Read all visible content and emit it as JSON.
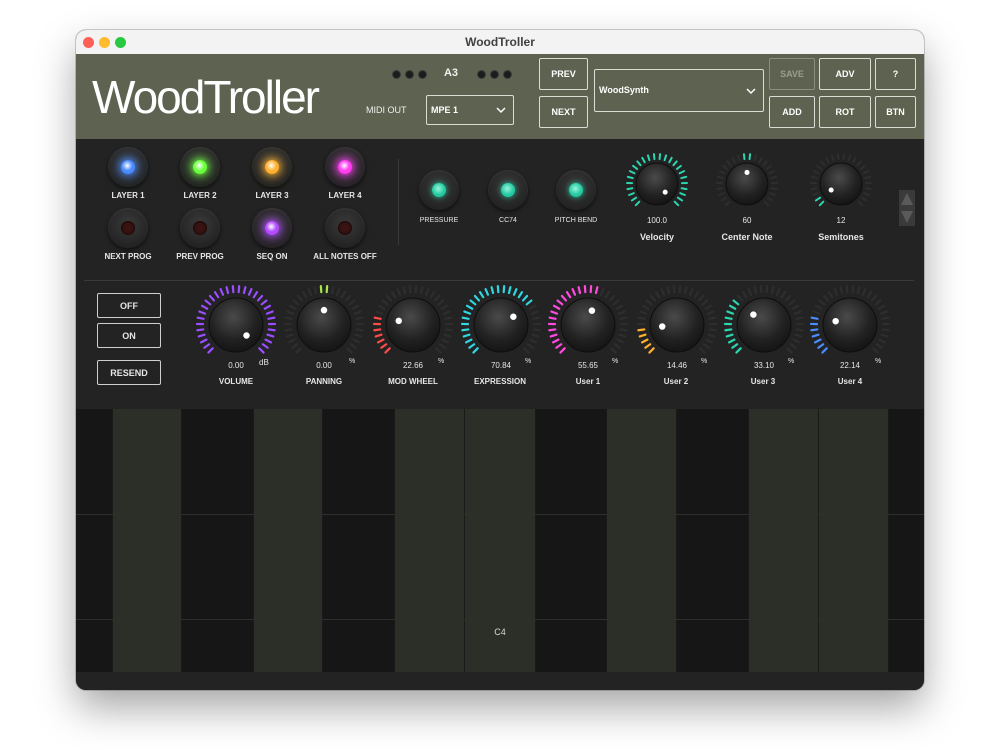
{
  "window": {
    "title": "WoodTroller"
  },
  "header": {
    "logo": "WoodTroller",
    "note_readout": "A3",
    "midi_out_label": "MIDI OUT",
    "midi_out_value": "MPE 1",
    "preset_value": "WoodSynth",
    "buttons": {
      "prev": "PREV",
      "next": "NEXT",
      "save": "SAVE",
      "add": "ADD",
      "adv": "ADV",
      "rot": "ROT",
      "help": "?",
      "btn": "BTN"
    }
  },
  "pads": [
    {
      "label": "LAYER 1",
      "color": "#4a8cff",
      "lit": true
    },
    {
      "label": "LAYER 2",
      "color": "#6bff3c",
      "lit": true
    },
    {
      "label": "LAYER 3",
      "color": "#ffb02e",
      "lit": true
    },
    {
      "label": "LAYER 4",
      "color": "#ff3cf2",
      "lit": true
    },
    {
      "label": "NEXT PROG",
      "color": "#6a1a1a",
      "lit": false
    },
    {
      "label": "PREV PROG",
      "color": "#6a1a1a",
      "lit": false
    },
    {
      "label": "SEQ ON",
      "color": "#b24bff",
      "lit": true
    },
    {
      "label": "ALL NOTES OFF",
      "color": "#6a1a1a",
      "lit": false
    }
  ],
  "expression_leds": [
    {
      "label": "PRESSURE",
      "color": "#22c9a0"
    },
    {
      "label": "CC74",
      "color": "#22c9a0"
    },
    {
      "label": "PITCH BEND",
      "color": "#22c9a0"
    }
  ],
  "top_knobs": [
    {
      "label": "Velocity",
      "value": "100.0",
      "fraction": 1.0,
      "color": "#2bd6b0"
    },
    {
      "label": "Center Note",
      "value": "60",
      "fraction": 0.5,
      "color": "#2bd6b0"
    },
    {
      "label": "Semitones",
      "value": "12",
      "fraction": 0.05,
      "color": "#2bd6b0"
    }
  ],
  "power_buttons": {
    "off": "OFF",
    "on": "ON",
    "resend": "RESEND"
  },
  "knobs": [
    {
      "label": "VOLUME",
      "value": "0.00",
      "unit": "dB",
      "fraction": 1.0,
      "color": "#9b4dff"
    },
    {
      "label": "PANNING",
      "value": "0.00",
      "unit": "%",
      "fraction": 0.5,
      "color": "#a6e84a"
    },
    {
      "label": "MOD WHEEL",
      "value": "22.66",
      "unit": "%",
      "fraction": 0.2266,
      "color": "#ff4a4a"
    },
    {
      "label": "EXPRESSION",
      "value": "70.84",
      "unit": "%",
      "fraction": 0.7084,
      "color": "#2fd6e0"
    },
    {
      "label": "User 1",
      "value": "55.65",
      "unit": "%",
      "fraction": 0.5565,
      "color": "#ff4ae0"
    },
    {
      "label": "User 2",
      "value": "14.46",
      "unit": "%",
      "fraction": 0.1446,
      "color": "#ffb02e"
    },
    {
      "label": "User 3",
      "value": "33.10",
      "unit": "%",
      "fraction": 0.331,
      "color": "#2bd6b0"
    },
    {
      "label": "User 4",
      "value": "22.14",
      "unit": "%",
      "fraction": 0.2214,
      "color": "#4a8cff"
    }
  ],
  "keyboard": {
    "marker": "C4"
  }
}
